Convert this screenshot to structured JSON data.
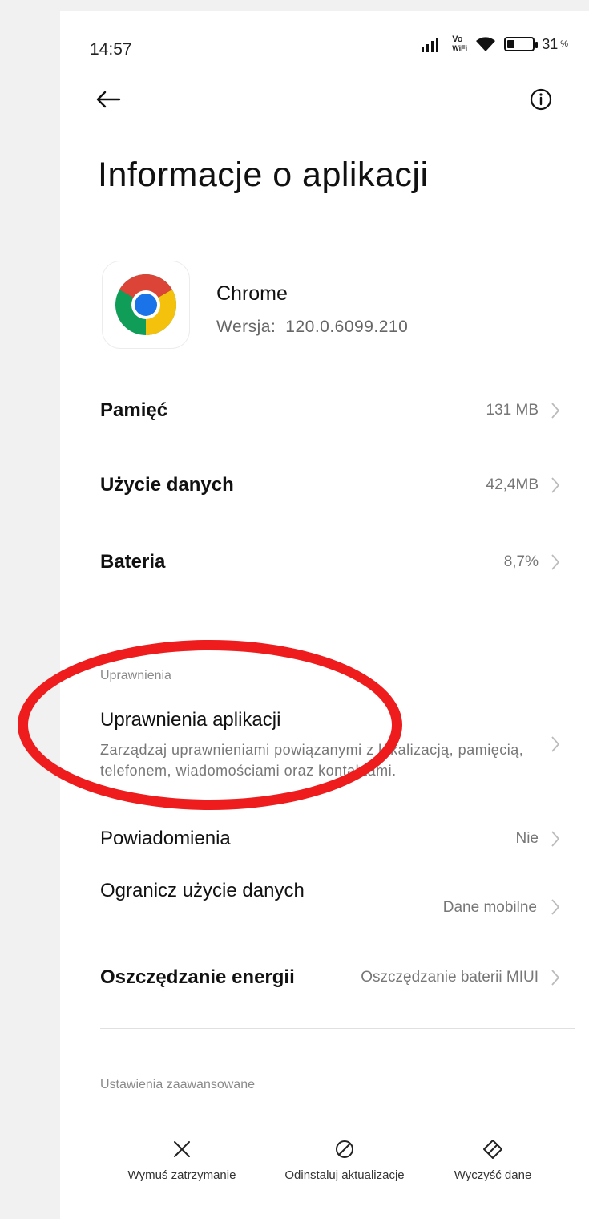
{
  "status_bar": {
    "time": "14:57",
    "volte_top": "Vo",
    "volte_bottom": "WiFi",
    "battery_percent": "31",
    "battery_suffix": "%",
    "battery_level": 0.31
  },
  "page": {
    "title": "Informacje o aplikacji"
  },
  "app": {
    "name": "Chrome",
    "version_label": "Wersja:",
    "version": "120.0.6099.210",
    "icon": "chrome-icon"
  },
  "rows": {
    "storage": {
      "label": "Pamięć",
      "value": "131 MB"
    },
    "data_usage": {
      "label": "Użycie danych",
      "value": "42,4MB"
    },
    "battery": {
      "label": "Bateria",
      "value": "8,7%"
    }
  },
  "permissions": {
    "caption": "Uprawnienia",
    "title": "Uprawnienia aplikacji",
    "description": "Zarządzaj uprawnieniami powiązanymi z lokalizacją, pamięcią, telefonem, wiadomościami oraz kontaktami."
  },
  "rows2": {
    "notifications": {
      "label": "Powiadomienia",
      "value": "Nie"
    },
    "restrict_data": {
      "label": "Ogranicz użycie danych",
      "value": "Dane mobilne"
    },
    "battery_saver": {
      "label": "Oszczędzanie energii",
      "value": "Oszczędzanie baterii MIUI"
    }
  },
  "advanced": {
    "caption": "Ustawienia zaawansowane"
  },
  "bottom_actions": [
    {
      "label": "Wymuś zatrzymanie",
      "icon": "close-icon"
    },
    {
      "label": "Odinstaluj aktualizacje",
      "icon": "block-icon"
    },
    {
      "label": "Wyczyść dane",
      "icon": "eraser-icon"
    }
  ],
  "colors": {
    "highlight": "#ee1c1c",
    "chrome_red": "#db4437",
    "chrome_yellow": "#f4c20d",
    "chrome_green": "#0f9d58",
    "chrome_blue": "#1a73e8"
  }
}
